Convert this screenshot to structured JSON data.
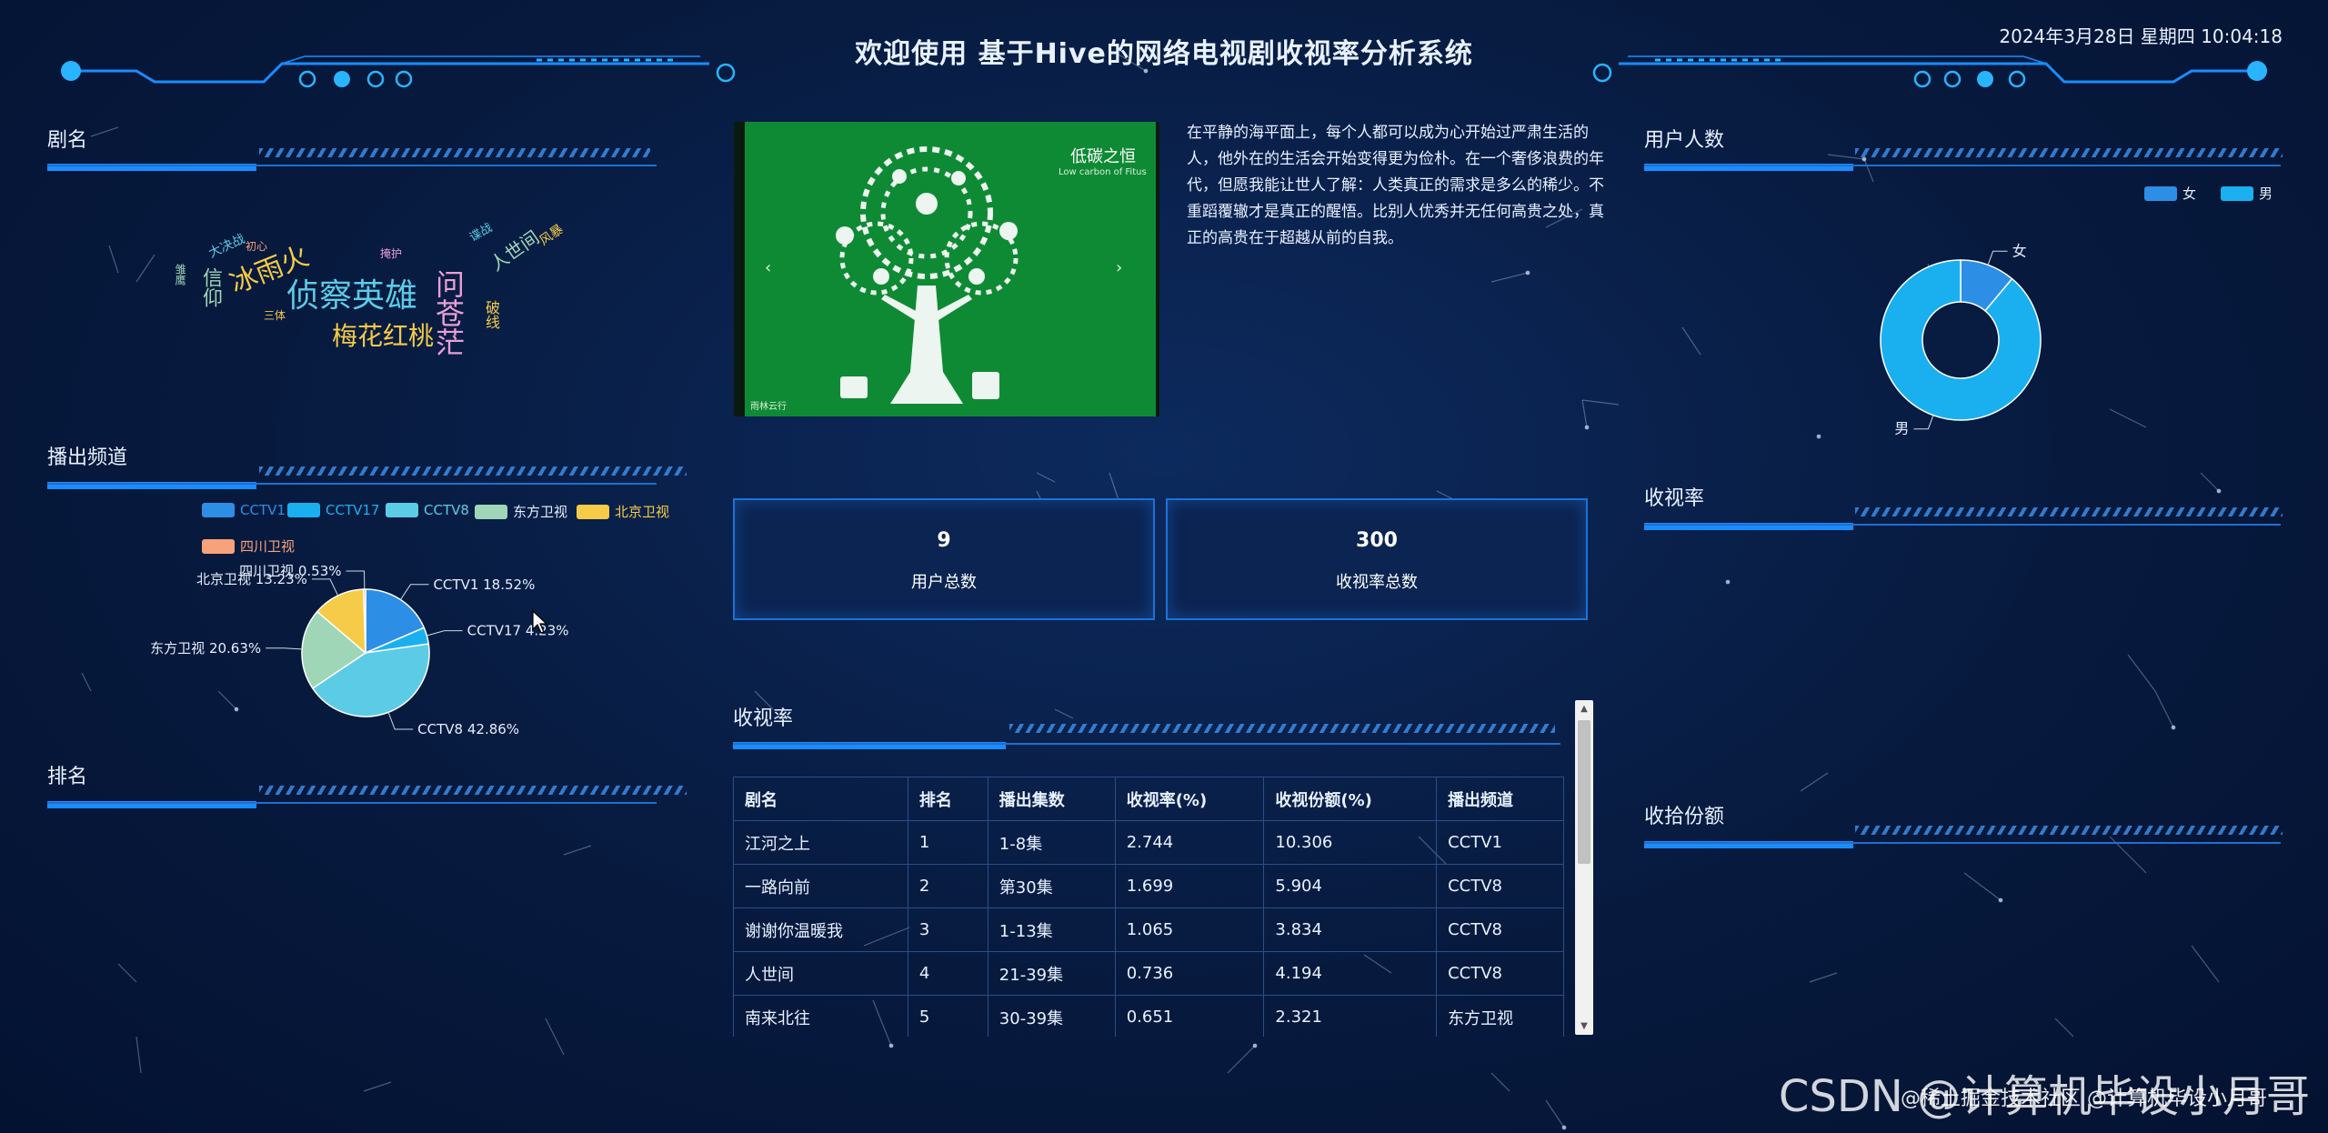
{
  "header": {
    "title": "欢迎使用 基于Hive的网络电视剧收视率分析系统",
    "datetime": "2024年3月28日 星期四 10:04:18"
  },
  "panels": {
    "drama_name": "剧名",
    "channel": "播出频道",
    "ranking": "排名",
    "ratings_table": "收视率",
    "user_count": "用户人数",
    "ratings": "收视率",
    "share": "收拾份额"
  },
  "word_cloud": {
    "words": [
      "侦察英雄",
      "梅花红桃",
      "冰雨火",
      "问苍茫",
      "人世间",
      "信仰",
      "大决战",
      "破线",
      "雏鹰",
      "三体",
      "初心",
      "谍战",
      "风暴",
      "掩护"
    ]
  },
  "channel_legend": [
    {
      "name": "CCTV1",
      "color": "#2d8ee6"
    },
    {
      "name": "CCTV17",
      "color": "#1ab0f0"
    },
    {
      "name": "CCTV8",
      "color": "#5ccbe6"
    },
    {
      "name": "东方卫视",
      "color": "#9fd6b8"
    },
    {
      "name": "北京卫视",
      "color": "#f5cb47"
    },
    {
      "name": "四川卫视",
      "color": "#f7a27a"
    }
  ],
  "chart_data": [
    {
      "type": "pie",
      "categories": [
        "CCTV1",
        "CCTV17",
        "CCTV8",
        "东方卫视",
        "北京卫视",
        "四川卫视"
      ],
      "values": [
        18.52,
        4.23,
        42.86,
        20.63,
        13.23,
        0.53
      ],
      "labels": [
        "CCTV1 18.52%",
        "CCTV17 4.23%",
        "CCTV8 42.86%",
        "东方卫视 20.63%",
        "北京卫视 13.23%",
        "四川卫视 0.53%"
      ],
      "colors": [
        "#2d8ee6",
        "#1ab0f0",
        "#5ccbe6",
        "#9fd6b8",
        "#f5cb47",
        "#f7a27a"
      ],
      "legend": "top"
    },
    {
      "type": "pie",
      "categories": [
        "女",
        "男"
      ],
      "values": [
        1,
        8
      ],
      "labels": [
        "女",
        "男"
      ],
      "colors": [
        "#2d8ee6",
        "#1ab0f0"
      ],
      "legend": "top-right"
    }
  ],
  "carousel": {
    "brand": "低碳之恒",
    "brand_sub": "Low carbon of Fitus",
    "footer": "雨林云行"
  },
  "article": "在平静的海平面上，每个人都可以成为心开始过严肃生活的人，他外在的生活会开始变得更为俭朴。在一个奢侈浪费的年代，但愿我能让世人了解：人类真正的需求是多么的稀少。不重蹈覆辙才是真正的醒悟。比别人优秀并无任何高贵之处，真正的高贵在于超越从前的自我。",
  "stats": [
    {
      "value": "9",
      "label": "用户总数"
    },
    {
      "value": "300",
      "label": "收视率总数"
    }
  ],
  "table": {
    "headers": [
      "剧名",
      "排名",
      "播出集数",
      "收视率(%)",
      "收视份额(%)",
      "播出频道"
    ],
    "rows": [
      [
        "江河之上",
        "1",
        "1-8集",
        "2.744",
        "10.306",
        "CCTV1"
      ],
      [
        "一路向前",
        "2",
        "第30集",
        "1.699",
        "5.904",
        "CCTV8"
      ],
      [
        "谢谢你温暖我",
        "3",
        "1-13集",
        "1.065",
        "3.834",
        "CCTV8"
      ],
      [
        "人世间",
        "4",
        "21-39集",
        "0.736",
        "4.194",
        "CCTV8"
      ],
      [
        "南来北往",
        "5",
        "30-39集",
        "0.651",
        "2.321",
        "东方卫视"
      ]
    ]
  },
  "watermark": "CSDN @计算机毕设小月哥",
  "watermark2": "@稀土掘金技术社区 @计算机毕设小月哥",
  "colors": {
    "accent": "#1a8cff",
    "background": "#071a3e",
    "carousel_bg": "#0f8a34"
  }
}
